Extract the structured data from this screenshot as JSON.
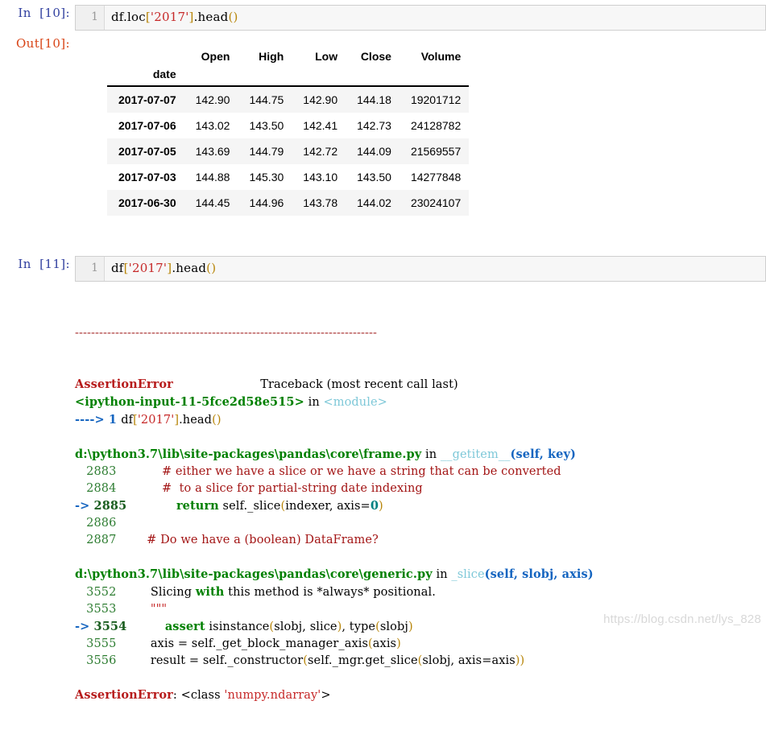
{
  "cells": [
    {
      "prompt": "In  [10]:",
      "line_number": "1",
      "code_segments": [
        {
          "text": "df",
          "cls": "tok-plain"
        },
        {
          "text": ".",
          "cls": "tok-plain"
        },
        {
          "text": "loc",
          "cls": "tok-plain"
        },
        {
          "text": "[",
          "cls": "tok-punct"
        },
        {
          "text": "'2017'",
          "cls": "tok-str"
        },
        {
          "text": "]",
          "cls": "tok-punct"
        },
        {
          "text": ".head",
          "cls": "tok-plain"
        },
        {
          "text": "()",
          "cls": "tok-punct"
        }
      ],
      "code_plain": "df.loc['2017'].head()"
    },
    {
      "prompt": "In  [11]:",
      "line_number": "1",
      "code_segments": [
        {
          "text": "df",
          "cls": "tok-plain"
        },
        {
          "text": "[",
          "cls": "tok-punct"
        },
        {
          "text": "'2017'",
          "cls": "tok-str"
        },
        {
          "text": "]",
          "cls": "tok-punct"
        },
        {
          "text": ".head",
          "cls": "tok-plain"
        },
        {
          "text": "()",
          "cls": "tok-punct"
        }
      ],
      "code_plain": "df['2017'].head()"
    }
  ],
  "output_10": {
    "prompt": "Out[10]:",
    "table": {
      "index_name": "date",
      "columns": [
        "Open",
        "High",
        "Low",
        "Close",
        "Volume"
      ],
      "rows": [
        {
          "index": "2017-07-07",
          "values": [
            "142.90",
            "144.75",
            "142.90",
            "144.18",
            "19201712"
          ]
        },
        {
          "index": "2017-07-06",
          "values": [
            "143.02",
            "143.50",
            "142.41",
            "142.73",
            "24128782"
          ]
        },
        {
          "index": "2017-07-05",
          "values": [
            "143.69",
            "144.79",
            "142.72",
            "144.09",
            "21569557"
          ]
        },
        {
          "index": "2017-07-03",
          "values": [
            "144.88",
            "145.30",
            "143.10",
            "143.50",
            "14277848"
          ]
        },
        {
          "index": "2017-06-30",
          "values": [
            "144.45",
            "144.96",
            "143.78",
            "144.02",
            "23024107"
          ]
        }
      ]
    }
  },
  "traceback": {
    "separator": "---------------------------------------------------------------------------",
    "lines": [
      {
        "name": "error-header",
        "segments": [
          {
            "text": "AssertionError",
            "cls": "tok-err"
          },
          {
            "text": "                       ",
            "cls": "tok-plain"
          },
          {
            "text": "Traceback (most recent call last)",
            "cls": "tok-trace-note"
          }
        ]
      },
      {
        "name": "frame-ipython-input",
        "segments": [
          {
            "text": "<ipython-input-11-5fce2d58e515>",
            "cls": "tok-path"
          },
          {
            "text": " in ",
            "cls": "tok-plain"
          },
          {
            "text": "<module>",
            "cls": "tok-module"
          }
        ]
      },
      {
        "name": "code-line-arrow",
        "segments": [
          {
            "text": "----> 1 ",
            "cls": "tok-arrow"
          },
          {
            "text": "df",
            "cls": "tok-plain"
          },
          {
            "text": "[",
            "cls": "tok-punct"
          },
          {
            "text": "'2017'",
            "cls": "tok-str"
          },
          {
            "text": "]",
            "cls": "tok-punct"
          },
          {
            "text": ".head",
            "cls": "tok-plain"
          },
          {
            "text": "()",
            "cls": "tok-punct"
          }
        ]
      },
      {
        "name": "blank",
        "segments": [
          {
            "text": " ",
            "cls": "tok-plain"
          }
        ]
      },
      {
        "name": "frame-frame-py",
        "segments": [
          {
            "text": "d:\\python3.7\\lib\\site-packages\\pandas\\core\\frame.py",
            "cls": "tok-path"
          },
          {
            "text": " in ",
            "cls": "tok-plain"
          },
          {
            "text": "__getitem__",
            "cls": "tok-func"
          },
          {
            "text": "(self, key)",
            "cls": "tok-args"
          }
        ]
      },
      {
        "name": "source-2883",
        "segments": [
          {
            "text": "   2883 ",
            "cls": "tok-lineno"
          },
          {
            "text": "           ",
            "cls": "tok-plain"
          },
          {
            "text": "# either we have a slice or we have a string that can be converted",
            "cls": "tok-comment"
          }
        ]
      },
      {
        "name": "source-2884",
        "segments": [
          {
            "text": "   2884 ",
            "cls": "tok-lineno"
          },
          {
            "text": "           ",
            "cls": "tok-plain"
          },
          {
            "text": "#  to a slice for partial-string date indexing",
            "cls": "tok-comment"
          }
        ]
      },
      {
        "name": "source-2885-current",
        "segments": [
          {
            "text": "-> ",
            "cls": "tok-arrow"
          },
          {
            "text": "2885 ",
            "cls": "tok-lineno-cur"
          },
          {
            "text": "            ",
            "cls": "tok-plain"
          },
          {
            "text": "return",
            "cls": "tok-kw"
          },
          {
            "text": " self._slice",
            "cls": "tok-plain"
          },
          {
            "text": "(",
            "cls": "tok-punct"
          },
          {
            "text": "indexer, axis=",
            "cls": "tok-plain"
          },
          {
            "text": "0",
            "cls": "tok-num"
          },
          {
            "text": ")",
            "cls": "tok-punct"
          }
        ]
      },
      {
        "name": "source-2886",
        "segments": [
          {
            "text": "   2886 ",
            "cls": "tok-lineno"
          }
        ]
      },
      {
        "name": "source-2887",
        "segments": [
          {
            "text": "   2887 ",
            "cls": "tok-lineno"
          },
          {
            "text": "       ",
            "cls": "tok-plain"
          },
          {
            "text": "# Do we have a (boolean) DataFrame?",
            "cls": "tok-comment"
          }
        ]
      },
      {
        "name": "blank",
        "segments": [
          {
            "text": " ",
            "cls": "tok-plain"
          }
        ]
      },
      {
        "name": "frame-generic-py",
        "segments": [
          {
            "text": "d:\\python3.7\\lib\\site-packages\\pandas\\core\\generic.py",
            "cls": "tok-path"
          },
          {
            "text": " in ",
            "cls": "tok-plain"
          },
          {
            "text": "_slice",
            "cls": "tok-func"
          },
          {
            "text": "(self, slobj, axis)",
            "cls": "tok-args"
          }
        ]
      },
      {
        "name": "source-3552",
        "segments": [
          {
            "text": "   3552 ",
            "cls": "tok-lineno"
          },
          {
            "text": "        Slicing ",
            "cls": "tok-plain"
          },
          {
            "text": "with",
            "cls": "tok-kw"
          },
          {
            "text": " this method is *always* positional.",
            "cls": "tok-plain"
          }
        ]
      },
      {
        "name": "source-3553",
        "segments": [
          {
            "text": "   3553 ",
            "cls": "tok-lineno"
          },
          {
            "text": "        ",
            "cls": "tok-plain"
          },
          {
            "text": "\"\"\"",
            "cls": "tok-str"
          }
        ]
      },
      {
        "name": "source-3554-current",
        "segments": [
          {
            "text": "-> ",
            "cls": "tok-arrow"
          },
          {
            "text": "3554 ",
            "cls": "tok-lineno-cur"
          },
          {
            "text": "         ",
            "cls": "tok-plain"
          },
          {
            "text": "assert",
            "cls": "tok-kw"
          },
          {
            "text": " isinstance",
            "cls": "tok-plain"
          },
          {
            "text": "(",
            "cls": "tok-punct"
          },
          {
            "text": "slobj, slice",
            "cls": "tok-plain"
          },
          {
            "text": ")",
            "cls": "tok-punct"
          },
          {
            "text": ", type",
            "cls": "tok-plain"
          },
          {
            "text": "(",
            "cls": "tok-punct"
          },
          {
            "text": "slobj",
            "cls": "tok-plain"
          },
          {
            "text": ")",
            "cls": "tok-punct"
          }
        ]
      },
      {
        "name": "source-3555",
        "segments": [
          {
            "text": "   3555 ",
            "cls": "tok-lineno"
          },
          {
            "text": "        axis = self._get_block_manager_axis",
            "cls": "tok-plain"
          },
          {
            "text": "(",
            "cls": "tok-punct"
          },
          {
            "text": "axis",
            "cls": "tok-plain"
          },
          {
            "text": ")",
            "cls": "tok-punct"
          }
        ]
      },
      {
        "name": "source-3556",
        "segments": [
          {
            "text": "   3556 ",
            "cls": "tok-lineno"
          },
          {
            "text": "        result = self._constructor",
            "cls": "tok-plain"
          },
          {
            "text": "(",
            "cls": "tok-punct"
          },
          {
            "text": "self._mgr.get_slice",
            "cls": "tok-plain"
          },
          {
            "text": "(",
            "cls": "tok-punct"
          },
          {
            "text": "slobj, axis=axis",
            "cls": "tok-plain"
          },
          {
            "text": "))",
            "cls": "tok-punct"
          }
        ]
      },
      {
        "name": "blank",
        "segments": [
          {
            "text": " ",
            "cls": "tok-plain"
          }
        ]
      },
      {
        "name": "error-footer",
        "segments": [
          {
            "text": "AssertionError",
            "cls": "tok-err"
          },
          {
            "text": ": <class ",
            "cls": "tok-plain"
          },
          {
            "text": "'numpy.ndarray'",
            "cls": "tok-str"
          },
          {
            "text": ">",
            "cls": "tok-plain"
          }
        ]
      }
    ]
  },
  "watermark": "https://blog.csdn.net/lys_828"
}
